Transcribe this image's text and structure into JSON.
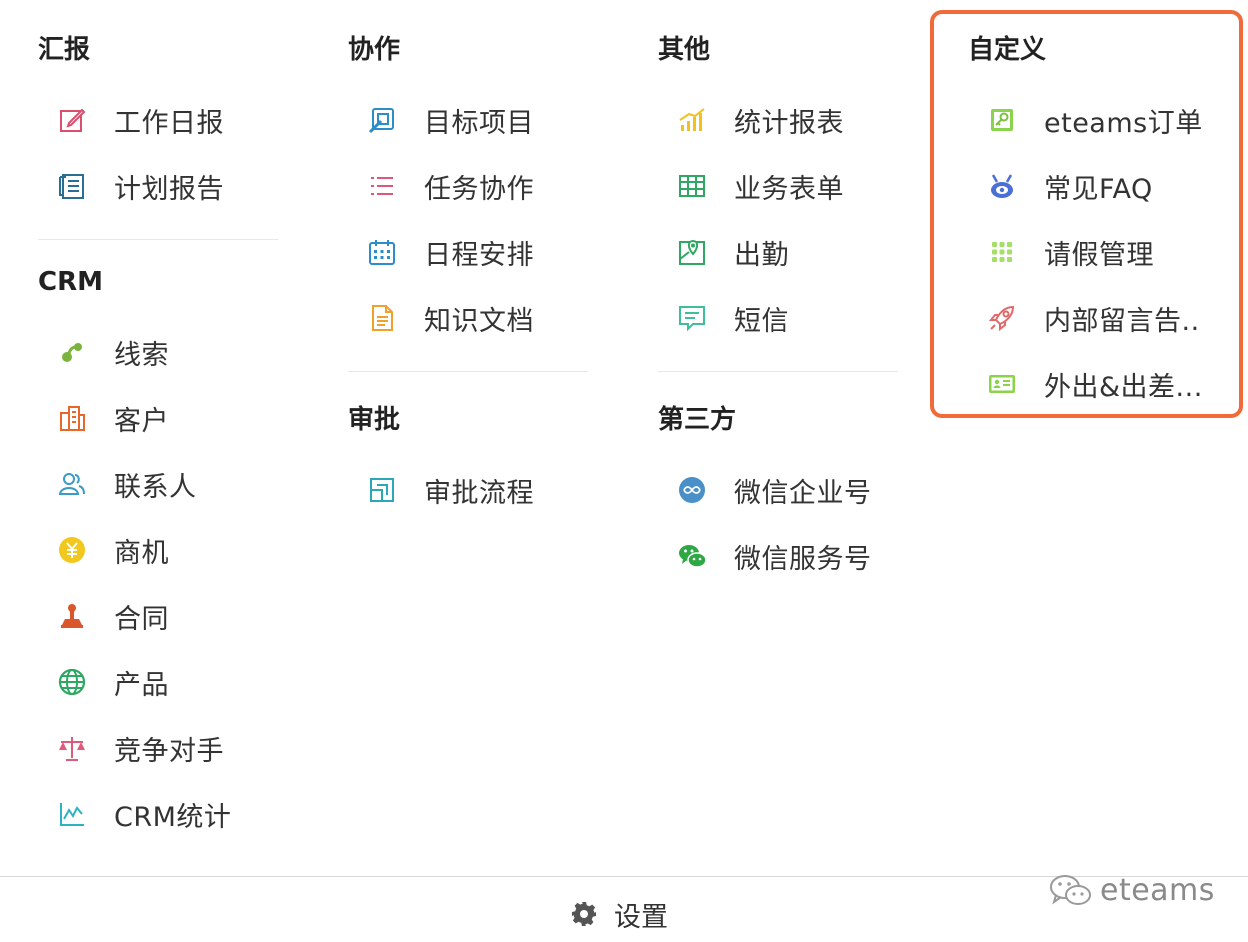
{
  "groups": {
    "report": {
      "title": "汇报",
      "items": [
        {
          "label": "工作日报",
          "icon": "edit-icon"
        },
        {
          "label": "计划报告",
          "icon": "document-icon"
        }
      ]
    },
    "crm": {
      "title": "CRM",
      "items": [
        {
          "label": "线索",
          "icon": "sprout-icon"
        },
        {
          "label": "客户",
          "icon": "building-icon"
        },
        {
          "label": "联系人",
          "icon": "contacts-icon"
        },
        {
          "label": "商机",
          "icon": "yen-coin-icon"
        },
        {
          "label": "合同",
          "icon": "stamp-icon"
        },
        {
          "label": "产品",
          "icon": "globe-icon"
        },
        {
          "label": "竞争对手",
          "icon": "scale-icon"
        },
        {
          "label": "CRM统计",
          "icon": "line-chart-icon"
        }
      ]
    },
    "collab": {
      "title": "协作",
      "items": [
        {
          "label": "目标项目",
          "icon": "target-icon"
        },
        {
          "label": "任务协作",
          "icon": "list-icon"
        },
        {
          "label": "日程安排",
          "icon": "calendar-icon"
        },
        {
          "label": "知识文档",
          "icon": "file-icon"
        }
      ]
    },
    "approval": {
      "title": "审批",
      "items": [
        {
          "label": "审批流程",
          "icon": "flow-icon"
        }
      ]
    },
    "other": {
      "title": "其他",
      "items": [
        {
          "label": "统计报表",
          "icon": "bar-chart-icon"
        },
        {
          "label": "业务表单",
          "icon": "table-icon"
        },
        {
          "label": "出勤",
          "icon": "map-pin-icon"
        },
        {
          "label": "短信",
          "icon": "message-icon"
        }
      ]
    },
    "third_party": {
      "title": "第三方",
      "items": [
        {
          "label": "微信企业号",
          "icon": "wechat-work-icon"
        },
        {
          "label": "微信服务号",
          "icon": "wechat-icon"
        }
      ]
    },
    "custom": {
      "title": "自定义",
      "items": [
        {
          "label": "eteams订单",
          "icon": "key-card-icon"
        },
        {
          "label": "常见FAQ",
          "icon": "faq-icon"
        },
        {
          "label": "请假管理",
          "icon": "grid-dots-icon"
        },
        {
          "label": "内部留言告..",
          "icon": "rocket-icon"
        },
        {
          "label": "外出&出差...",
          "icon": "id-card-icon"
        }
      ]
    }
  },
  "footer": {
    "settings_label": "设置",
    "settings_icon": "gear-icon"
  },
  "watermark": {
    "text": "eteams",
    "icon": "wechat-logo-icon"
  },
  "colors": {
    "highlight_border": "#f06a3a",
    "text": "#333333",
    "title": "#222222",
    "divider": "#e8e8e8"
  }
}
